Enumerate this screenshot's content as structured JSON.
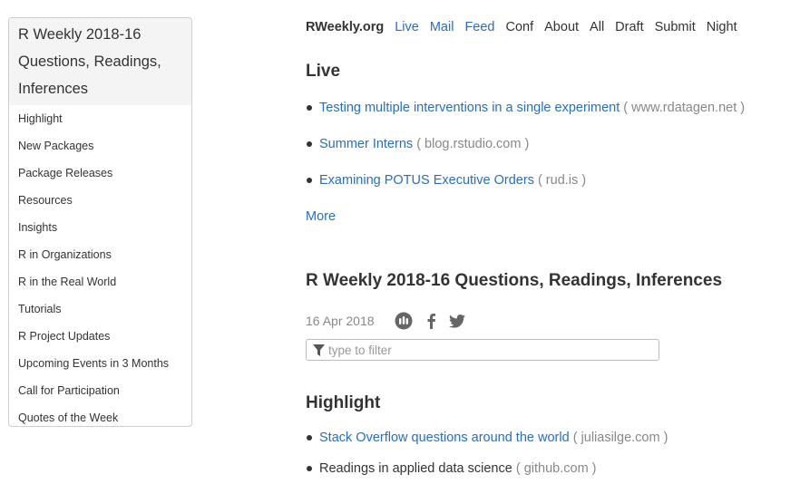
{
  "sidebar": {
    "title": "R Weekly 2018-16 Questions, Readings, Inferences",
    "items": [
      {
        "label": "Highlight"
      },
      {
        "label": "New Packages"
      },
      {
        "label": "Package Releases"
      },
      {
        "label": "Resources"
      },
      {
        "label": "Insights"
      },
      {
        "label": "R in Organizations"
      },
      {
        "label": "R in the Real World"
      },
      {
        "label": "Tutorials"
      },
      {
        "label": "R Project Updates"
      },
      {
        "label": "Upcoming Events in 3 Months"
      },
      {
        "label": "Call for Participation"
      },
      {
        "label": "Quotes of the Week"
      }
    ]
  },
  "nav": {
    "brand": "RWeekly.org",
    "items": [
      "Live",
      "Mail",
      "Feed",
      "Conf",
      "About",
      "All",
      "Draft",
      "Submit",
      "Night"
    ]
  },
  "live": {
    "heading": "Live",
    "items": [
      {
        "title": "Testing multiple interventions in a single experiment",
        "source": "( www.rdatagen.net )"
      },
      {
        "title": "Summer Interns",
        "source": "( blog.rstudio.com )"
      },
      {
        "title": "Examining POTUS Executive Orders",
        "source": "( rud.is )"
      }
    ],
    "more": "More"
  },
  "post": {
    "title": "R Weekly 2018-16 Questions, Readings, Inferences",
    "date": "16 Apr 2018",
    "filter_placeholder": "type to filter"
  },
  "highlight": {
    "heading": "Highlight",
    "items": [
      {
        "title": "Stack Overflow questions around the world",
        "source": "( juliasilge.com )"
      },
      {
        "title": "Readings in applied data science",
        "source": "( github.com )"
      }
    ]
  },
  "colors": {
    "link": "#2a6ebb",
    "text": "#333333",
    "muted": "#888888"
  },
  "icons": [
    "filter-icon",
    "weibo-icon",
    "facebook-icon",
    "twitter-icon"
  ]
}
